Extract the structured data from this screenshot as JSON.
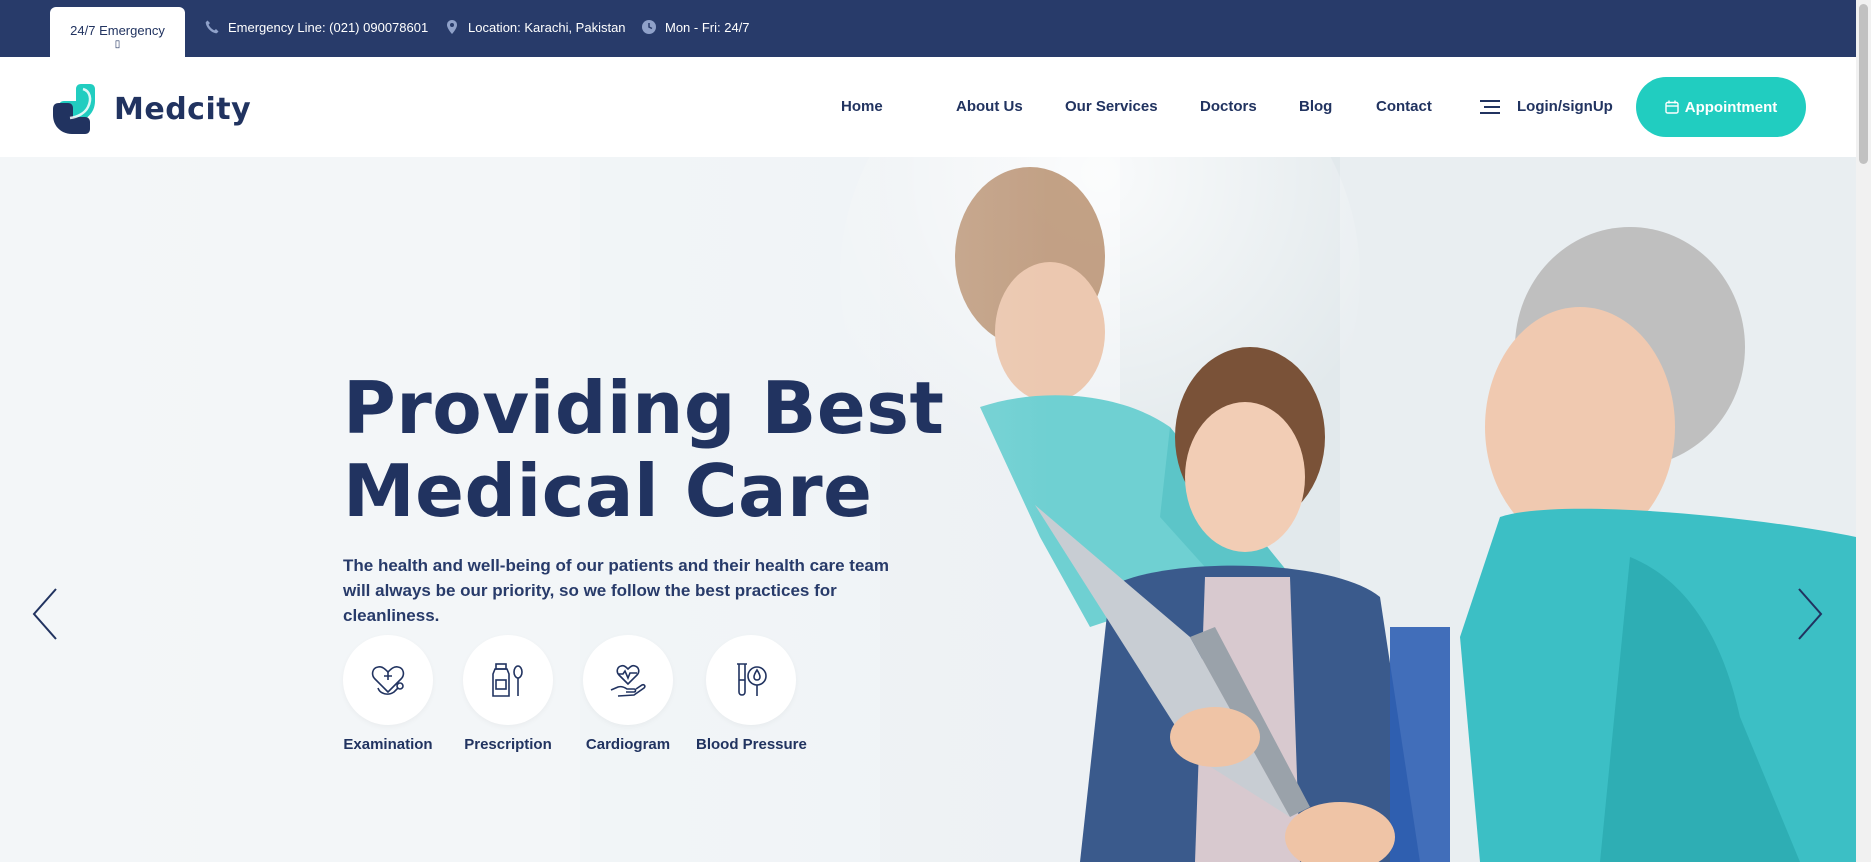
{
  "topbar": {
    "emergency_label": "24/7 Emergency",
    "emergency_icon": "▯",
    "phone": "Emergency Line: (021) 090078601",
    "location": "Location: Karachi, Pakistan",
    "hours": "Mon - Fri: 24/7"
  },
  "header": {
    "logo_text": "Medcity",
    "nav": {
      "home": "Home",
      "about": "About Us",
      "services": "Our Services",
      "doctors": "Doctors",
      "blog": "Blog",
      "contact": "Contact"
    },
    "login": "Login/signUp",
    "appointment": "Appointment"
  },
  "hero": {
    "title_line1": "Providing Best",
    "title_line2": "Medical Care",
    "description": "The health and well-being of our patients and their health care team will always be our priority, so we follow the best practices for cleanliness.",
    "features": [
      {
        "label": "Examination",
        "icon": "stethoscope-heart-icon"
      },
      {
        "label": "Prescription",
        "icon": "medicine-bottle-spoon-icon"
      },
      {
        "label": "Cardiogram",
        "icon": "heart-hand-icon"
      },
      {
        "label": "Blood Pressure",
        "icon": "test-tube-drop-icon"
      }
    ]
  },
  "colors": {
    "navy": "#213360",
    "topbar": "#283b6a",
    "accent": "#21cdc0",
    "scrub": "#3ec3c6"
  }
}
